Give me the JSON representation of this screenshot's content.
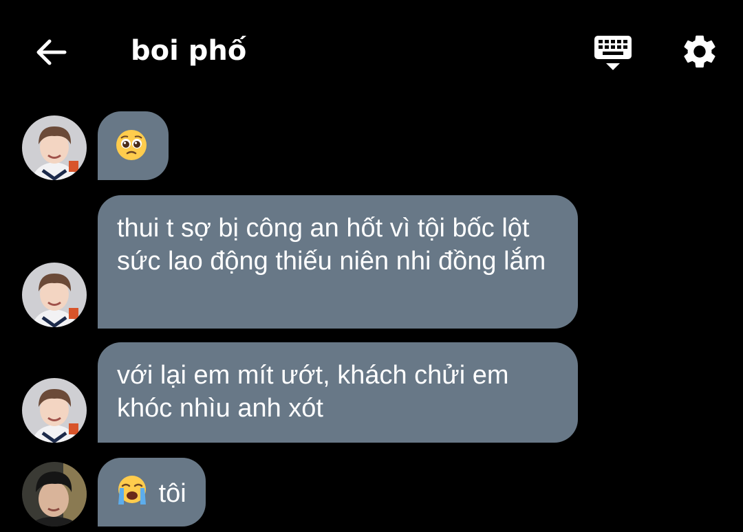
{
  "header": {
    "title": "boi phố",
    "back_icon": "arrow-left-icon",
    "keyboard_icon": "keyboard-hide-icon",
    "settings_icon": "gear-icon"
  },
  "colors": {
    "background": "#000000",
    "bubble": "#687887",
    "text": "#ffffff"
  },
  "messages": [
    {
      "emoji": "pleading-face-emoji",
      "text": ""
    },
    {
      "text": "thui t sợ bị công an hốt vì tội bốc lột sức lao động thiếu niên nhi đồng lắm"
    },
    {
      "text": "với lại em mít ướt, khách chửi em khóc nhìu anh xót"
    },
    {
      "emoji": "loudly-crying-face-emoji",
      "text": "tôi"
    }
  ]
}
